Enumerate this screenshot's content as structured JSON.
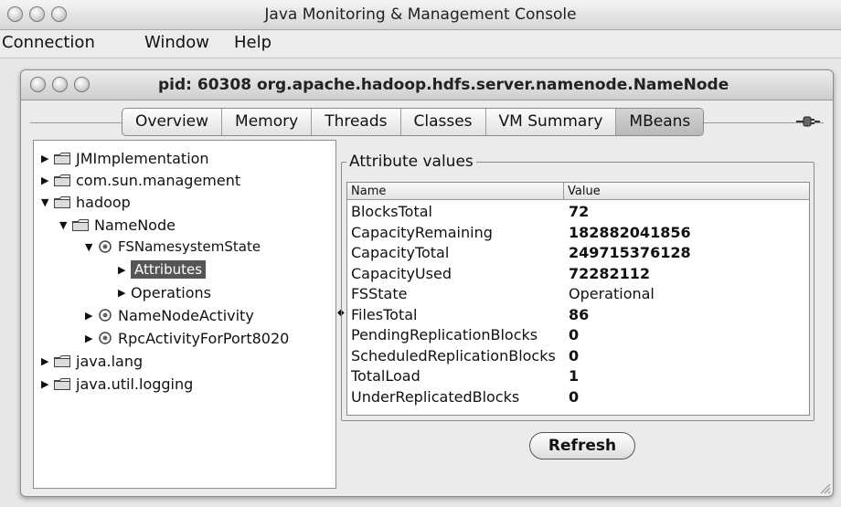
{
  "window": {
    "title": "Java Monitoring & Management Console"
  },
  "menu": [
    "Connection",
    "Window",
    "Help"
  ],
  "inner_window": {
    "title": "pid: 60308 org.apache.hadoop.hdfs.server.namenode.NameNode"
  },
  "tabs": [
    {
      "label": "Overview"
    },
    {
      "label": "Memory"
    },
    {
      "label": "Threads"
    },
    {
      "label": "Classes"
    },
    {
      "label": "VM Summary"
    },
    {
      "label": "MBeans",
      "active": true
    }
  ],
  "tree": [
    {
      "label": "JMImplementation",
      "icon": "folder-icon",
      "expanded": false
    },
    {
      "label": "com.sun.management",
      "icon": "folder-icon",
      "expanded": false
    },
    {
      "label": "hadoop",
      "icon": "folder-icon",
      "expanded": true
    },
    {
      "label": "NameNode",
      "icon": "folder-icon",
      "expanded": true
    },
    {
      "label": "FSNamesystemState",
      "icon": "mbean-icon",
      "expanded": true
    },
    {
      "label": "Attributes",
      "selected": true
    },
    {
      "label": "Operations"
    },
    {
      "label": "NameNodeActivity",
      "icon": "mbean-icon",
      "expanded": false
    },
    {
      "label": "RpcActivityForPort8020",
      "icon": "mbean-icon",
      "expanded": false
    },
    {
      "label": "java.lang",
      "icon": "folder-icon",
      "expanded": false
    },
    {
      "label": "java.util.logging",
      "icon": "folder-icon",
      "expanded": false
    }
  ],
  "attributes": {
    "group_title": "Attribute values",
    "columns": [
      "Name",
      "Value"
    ],
    "rows": [
      {
        "name": "BlocksTotal",
        "value": "72"
      },
      {
        "name": "CapacityRemaining",
        "value": "182882041856"
      },
      {
        "name": "CapacityTotal",
        "value": "249715376128"
      },
      {
        "name": "CapacityUsed",
        "value": "72282112"
      },
      {
        "name": "FSState",
        "value": "Operational"
      },
      {
        "name": "FilesTotal",
        "value": "86"
      },
      {
        "name": "PendingReplicationBlocks",
        "value": "0"
      },
      {
        "name": "ScheduledReplicationBlocks",
        "value": "0"
      },
      {
        "name": "TotalLoad",
        "value": "1"
      },
      {
        "name": "UnderReplicatedBlocks",
        "value": "0"
      }
    ]
  },
  "buttons": {
    "refresh": "Refresh"
  }
}
